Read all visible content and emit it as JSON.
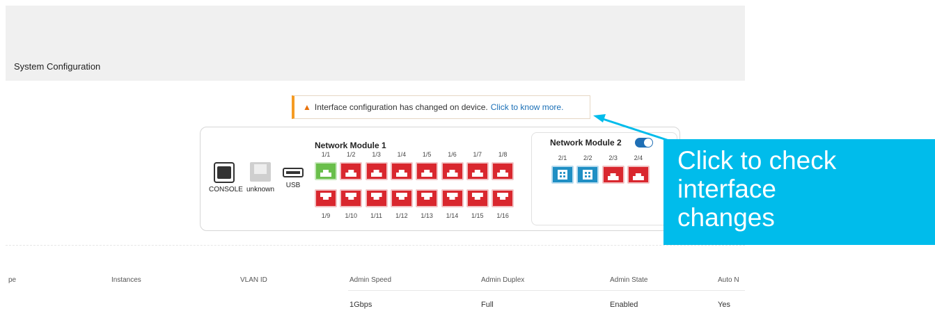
{
  "header": {
    "title": "System Configuration"
  },
  "alert": {
    "message": "Interface configuration has changed on device.",
    "link": "Click to know more."
  },
  "mgmt_ports": [
    {
      "label": "CONSOLE"
    },
    {
      "label": "unknown"
    },
    {
      "label": "USB"
    }
  ],
  "network_module_1": {
    "title": "Network Module 1",
    "top_ports": [
      "1/1",
      "1/2",
      "1/3",
      "1/4",
      "1/5",
      "1/6",
      "1/7",
      "1/8"
    ],
    "bottom_ports": [
      "1/9",
      "1/10",
      "1/11",
      "1/12",
      "1/13",
      "1/14",
      "1/15",
      "1/16"
    ],
    "top_status": [
      "up",
      "down",
      "down",
      "down",
      "down",
      "down",
      "down",
      "down"
    ],
    "bottom_status": [
      "down",
      "down",
      "down",
      "down",
      "down",
      "down",
      "down",
      "down"
    ]
  },
  "network_module_2": {
    "title": "Network Module 2",
    "toggle_on": true,
    "ports": [
      "2/1",
      "2/2",
      "2/3",
      "2/4"
    ],
    "port_types": [
      "fiber",
      "fiber",
      "copper",
      "copper"
    ]
  },
  "table": {
    "headers": [
      "pe",
      "Instances",
      "VLAN ID",
      "Admin Speed",
      "Admin Duplex",
      "Admin State",
      "Auto N"
    ],
    "row": {
      "admin_speed": "1Gbps",
      "admin_duplex": "Full",
      "admin_state": "Enabled",
      "auto_neg": "Yes"
    }
  },
  "callout": {
    "lines": [
      "Click to check",
      "interface",
      "changes"
    ]
  },
  "colors": {
    "port_down": "#d9272e",
    "port_up": "#6abf4b",
    "port_fiber": "#1f8fc4",
    "callout": "#00bceb",
    "alert_accent": "#f59b23"
  }
}
